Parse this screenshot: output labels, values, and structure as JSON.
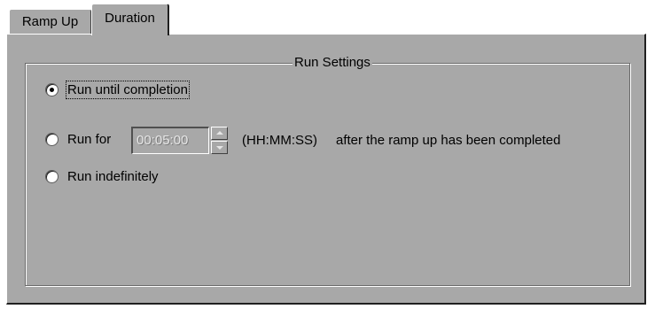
{
  "tabs": [
    {
      "label": "Ramp Up",
      "active": false
    },
    {
      "label": "Duration",
      "active": true
    }
  ],
  "run_settings": {
    "title": "Run Settings",
    "options": [
      {
        "label": "Run until completion",
        "checked": true
      },
      {
        "label": "Run for",
        "checked": false
      },
      {
        "label": "Run indefinitely",
        "checked": false
      }
    ],
    "duration": {
      "value": "00:05:00",
      "enabled": false,
      "format_label": "(HH:MM:SS)",
      "suffix_label": "after the ramp up has been completed"
    }
  },
  "icons": {
    "spin_up": "chevron-up-icon",
    "spin_down": "chevron-down-icon"
  }
}
